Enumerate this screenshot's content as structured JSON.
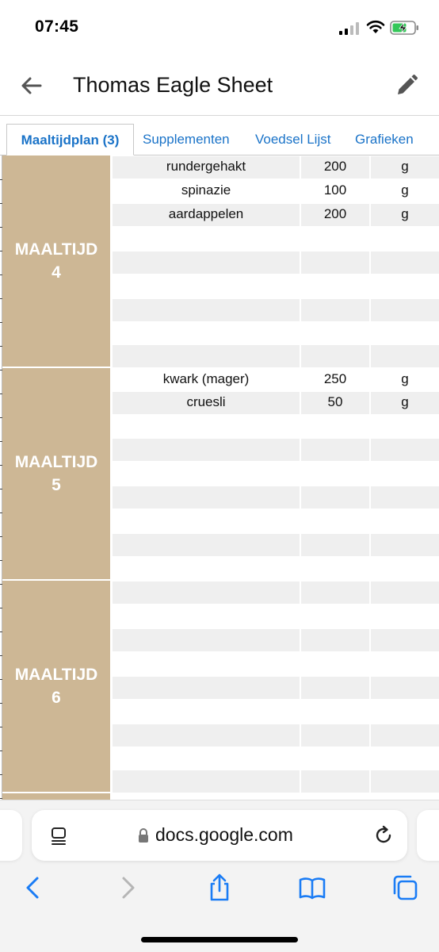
{
  "status": {
    "time": "07:45"
  },
  "header": {
    "title": "Thomas Eagle Sheet"
  },
  "tabs": [
    {
      "label": "Maaltijdplan (3)",
      "active": true
    },
    {
      "label": "Supplementen",
      "active": false
    },
    {
      "label": "Voedsel Lijst",
      "active": false
    },
    {
      "label": "Grafieken",
      "active": false
    }
  ],
  "meals": [
    {
      "word": "MAALTIJD",
      "number": "4",
      "items": [
        {
          "food": "rundergehakt",
          "amount": "200",
          "unit": "g"
        },
        {
          "food": "spinazie",
          "amount": "100",
          "unit": "g"
        },
        {
          "food": "aardappelen",
          "amount": "200",
          "unit": "g"
        }
      ]
    },
    {
      "word": "MAALTIJD",
      "number": "5",
      "items": [
        {
          "food": "kwark (mager)",
          "amount": "250",
          "unit": "g"
        },
        {
          "food": "cruesli",
          "amount": "50",
          "unit": "g"
        }
      ]
    },
    {
      "word": "MAALTIJD",
      "number": "6",
      "items": []
    }
  ],
  "browser": {
    "url": "docs.google.com"
  },
  "colors": {
    "meal_block": "#cdb795",
    "tab_link": "#1a73c8",
    "row_shade": "#efefef"
  }
}
